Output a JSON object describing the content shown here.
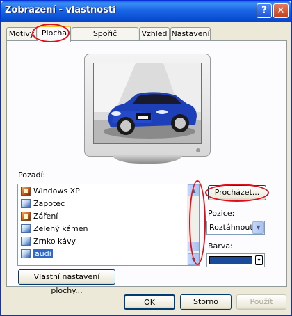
{
  "window": {
    "title": "Zobrazení - vlastnosti",
    "help_label": "?",
    "close_label": "✕"
  },
  "tabs": [
    {
      "label": "Motivy"
    },
    {
      "label": "Plocha",
      "active": true
    },
    {
      "label": "Spořič obrazovky"
    },
    {
      "label": "Vzhled"
    },
    {
      "label": "Nastavení"
    }
  ],
  "background": {
    "label": "Pozadí:",
    "items": [
      {
        "label": "Windows XP",
        "icon": "picture-file-icon"
      },
      {
        "label": "Zapotec",
        "icon": "brush-file-icon"
      },
      {
        "label": "Záření",
        "icon": "picture-file-icon"
      },
      {
        "label": "Zelený kámen",
        "icon": "brush-file-icon"
      },
      {
        "label": "Zrnko kávy",
        "icon": "brush-file-icon"
      },
      {
        "label": "audi",
        "icon": "brush-file-icon",
        "selected": true
      }
    ]
  },
  "browse_button": "Procházet...",
  "position": {
    "label": "Pozice:",
    "value": "Roztáhnout"
  },
  "color": {
    "label": "Barva:",
    "value": "#1c4a9a"
  },
  "customize_button": "Vlastní nastavení plochy...",
  "footer": {
    "ok": "OK",
    "cancel": "Storno",
    "apply": "Použít"
  },
  "accent": {
    "highlight_ring": "#e0101a",
    "selection": "#316ac5"
  }
}
